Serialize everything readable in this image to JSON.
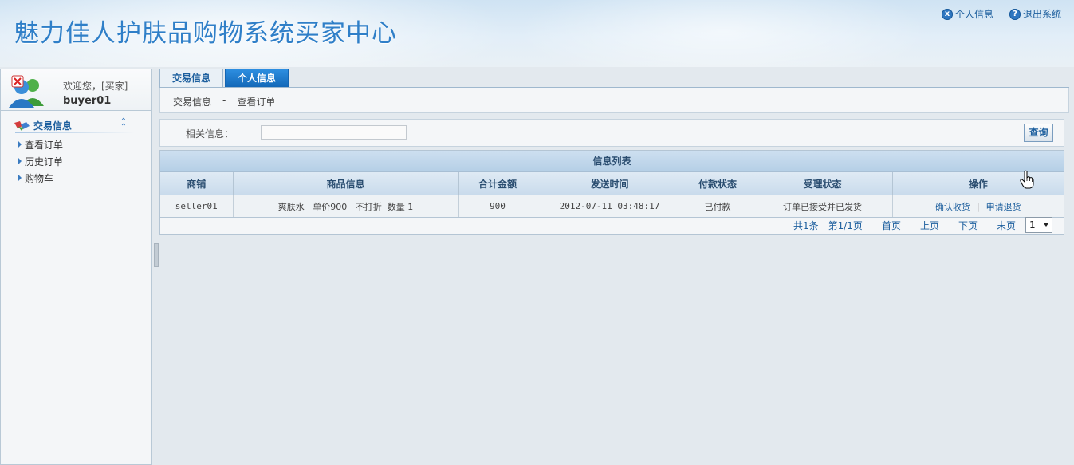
{
  "header": {
    "title": "魅力佳人护肤品购物系统买家中心",
    "links": [
      {
        "icon": "close-circle-icon",
        "glyph": "x",
        "label": "个人信息"
      },
      {
        "icon": "help-circle-icon",
        "glyph": "?",
        "label": "退出系统"
      }
    ]
  },
  "sidebar": {
    "welcome": "欢迎您，[买家]",
    "username": "buyer01",
    "menu_title": "交易信息",
    "items": [
      "查看订单",
      "历史订单",
      "购物车"
    ]
  },
  "tabs": [
    {
      "label": "交易信息",
      "active": true
    },
    {
      "label": "个人信息",
      "active": false
    }
  ],
  "breadcrumb": {
    "section": "交易信息",
    "separator": "-",
    "page": "查看订单"
  },
  "search": {
    "label": "相关信息：",
    "value": "",
    "button": "查询"
  },
  "list": {
    "title": "信息列表",
    "columns": [
      "商铺",
      "商品信息",
      "合计金额",
      "发送时间",
      "付款状态",
      "受理状态",
      "操作"
    ],
    "rows": [
      {
        "shop": "seller01",
        "product": "爽肤水   单价900   不打折  数量 1",
        "total": "900",
        "time": "2012-07-11 03:48:17",
        "pay_status": "已付款",
        "process_status": "订单已接受并已发货",
        "actions": [
          "确认收货",
          "申请退货"
        ],
        "action_separator": "|"
      }
    ]
  },
  "pager": {
    "total": "共1条",
    "page_info": "第1/1页",
    "first": "首页",
    "prev": "上页",
    "next": "下页",
    "last": "末页",
    "selected_page": "1"
  },
  "colors": {
    "accent": "#1d5f9e",
    "tab_blue": "#1368b8",
    "title_blue": "#2f7fc8"
  }
}
